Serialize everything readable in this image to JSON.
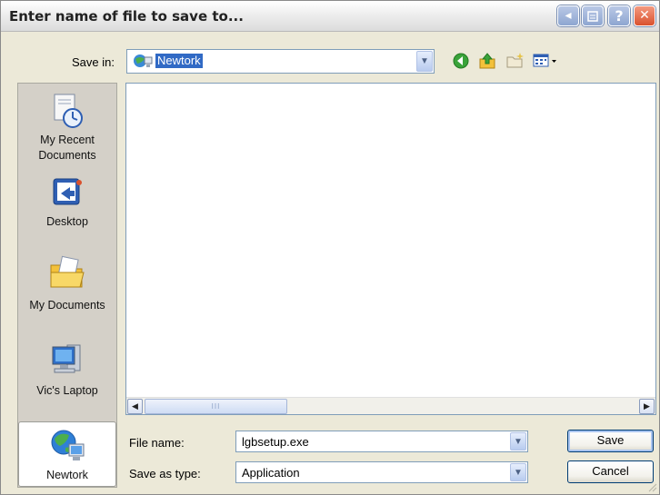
{
  "window": {
    "title": "Enter name of file to save to..."
  },
  "title_buttons": {
    "back_glyph": "◂",
    "help_glyph": "?",
    "close_glyph": "✕"
  },
  "save_in": {
    "label": "Save in:",
    "value": "Newtork",
    "icon": "network-icon"
  },
  "toolbar": {
    "icons": [
      "back-icon",
      "up-folder-icon",
      "new-folder-icon",
      "views-menu-icon"
    ]
  },
  "places": [
    {
      "label_line1": "My Recent",
      "label_line2": "Documents",
      "icon": "recent-documents-icon"
    },
    {
      "label_line1": "Desktop",
      "label_line2": "",
      "icon": "desktop-icon"
    },
    {
      "label_line1": "My Documents",
      "label_line2": "",
      "icon": "my-documents-icon"
    },
    {
      "label_line1": "Vic's Laptop",
      "label_line2": "",
      "icon": "computer-icon"
    },
    {
      "label_line1": "Newtork",
      "label_line2": "",
      "icon": "network-icon"
    }
  ],
  "file_list": {
    "items": [],
    "scroll": {
      "thumb_grip": "III"
    }
  },
  "file_name": {
    "label": "File name:",
    "value": "lgbsetup.exe"
  },
  "save_as_type": {
    "label": "Save as type:",
    "value": "Application"
  },
  "buttons": {
    "save": "Save",
    "cancel": "Cancel"
  },
  "colors": {
    "accent": "#316ac5",
    "dialog_bg": "#ece9d8",
    "places_bg": "#d4d0c8",
    "close_red": "#d9512e"
  }
}
